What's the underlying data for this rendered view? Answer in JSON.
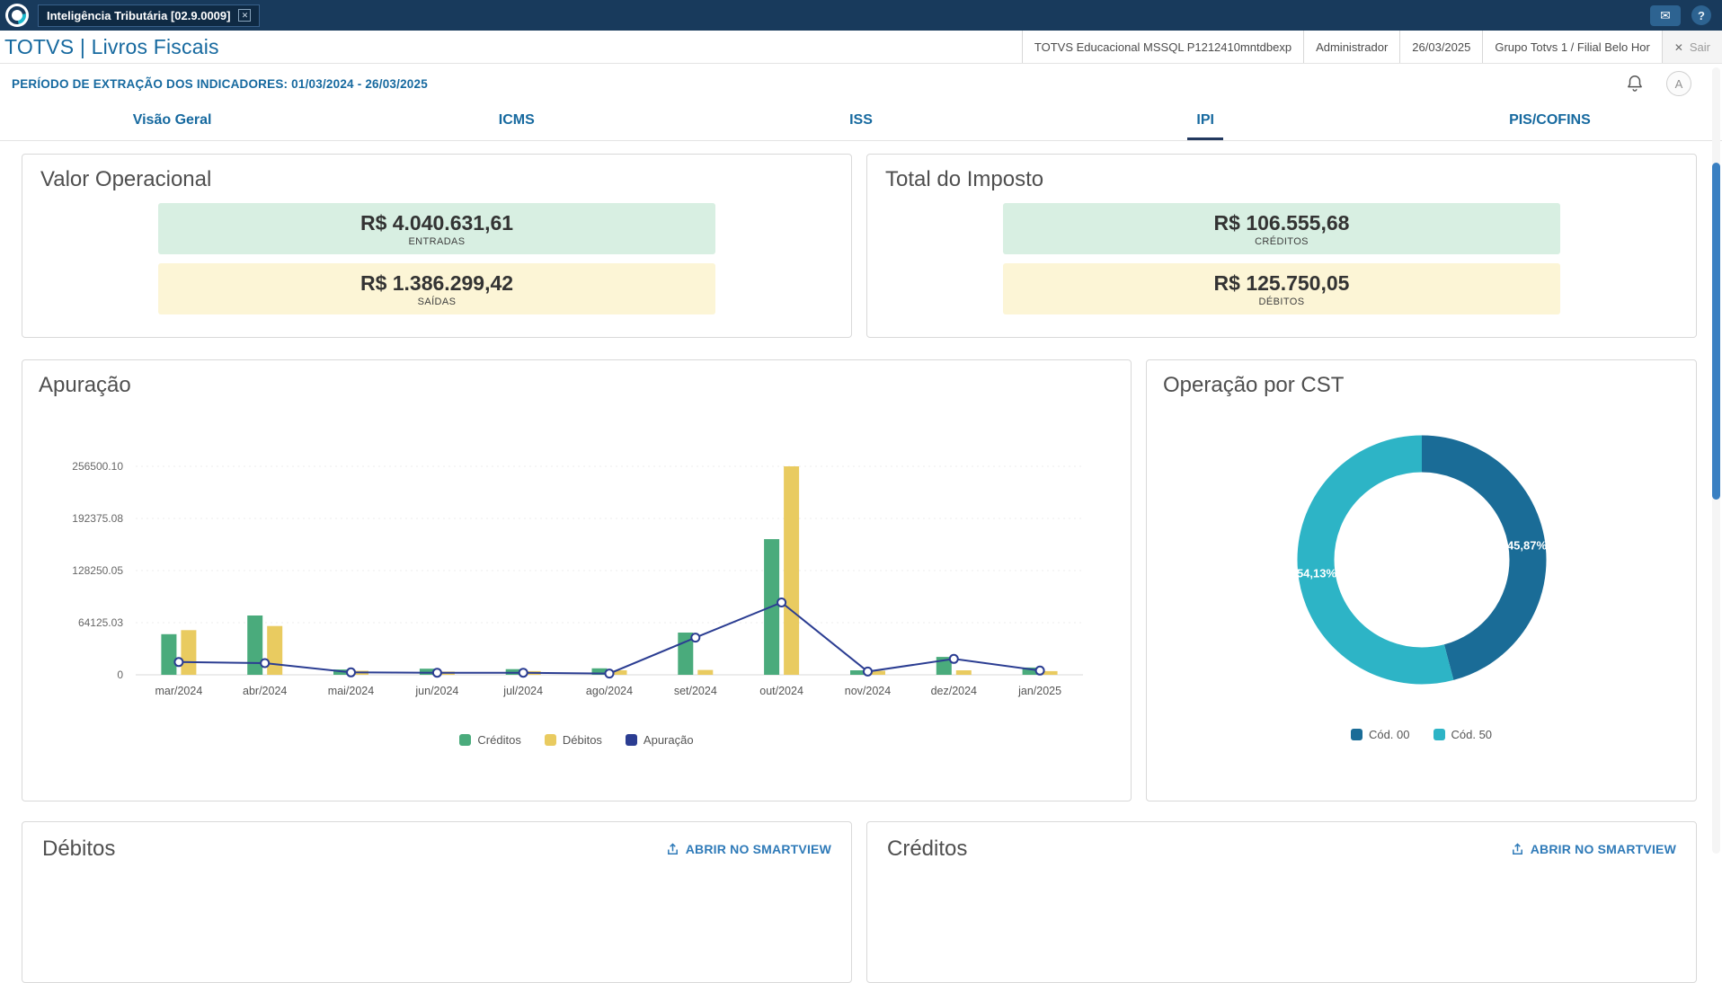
{
  "topbar": {
    "tab_title": "Inteligência Tributária [02.9.0009]"
  },
  "header": {
    "app_title": "TOTVS | Livros Fiscais",
    "environment": "TOTVS Educacional MSSQL P1212410mntdbexp",
    "user": "Administrador",
    "date": "26/03/2025",
    "branch": "Grupo Totvs 1 / Filial Belo Hor",
    "logout_label": "Sair"
  },
  "period_label": "PERÍODO DE EXTRAÇÃO DOS INDICADORES: 01/03/2024 - 26/03/2025",
  "avatar_letter": "A",
  "tabs": [
    {
      "label": "Visão Geral"
    },
    {
      "label": "ICMS"
    },
    {
      "label": "ISS"
    },
    {
      "label": "IPI"
    },
    {
      "label": "PIS/COFINS"
    }
  ],
  "active_tab": "IPI",
  "summary_cards": {
    "valor_operacional": {
      "title": "Valor Operacional",
      "entries": {
        "value": "R$ 4.040.631,61",
        "label": "ENTRADAS"
      },
      "exits": {
        "value": "R$ 1.386.299,42",
        "label": "SAÍDAS"
      }
    },
    "total_imposto": {
      "title": "Total do Imposto",
      "credits": {
        "value": "R$ 106.555,68",
        "label": "CRÉDITOS"
      },
      "debits": {
        "value": "R$ 125.750,05",
        "label": "DÉBITOS"
      }
    }
  },
  "bottom_cards": {
    "debitos": {
      "title": "Débitos",
      "link": "ABRIR NO SMARTVIEW"
    },
    "creditos": {
      "title": "Créditos",
      "link": "ABRIR NO SMARTVIEW"
    }
  },
  "colors": {
    "entry_bg": "#d8efe2",
    "exit_bg": "#fcf5d6",
    "credit_green": "#4aab7c",
    "debit_yellow": "#e9cb60",
    "line_navy": "#2b3d92",
    "cst00_blue": "#1a6c97",
    "cst50_teal": "#2db4c6",
    "accent_blue": "#16699f",
    "topbar_navy": "#183a5c"
  },
  "chart_data": [
    {
      "type": "bar",
      "title": "Apuração",
      "categories": [
        "mar/2024",
        "abr/2024",
        "mai/2024",
        "jun/2024",
        "jul/2024",
        "ago/2024",
        "set/2024",
        "out/2024",
        "nov/2024",
        "dez/2024",
        "jan/2025"
      ],
      "series": [
        {
          "name": "Créditos",
          "kind": "bar",
          "color": "#4aab7c",
          "values": [
            50000,
            73000,
            6500,
            7500,
            7000,
            8000,
            52000,
            167000,
            5500,
            22000,
            9000
          ]
        },
        {
          "name": "Débitos",
          "kind": "bar",
          "color": "#e9cb60",
          "values": [
            55000,
            60000,
            5000,
            4000,
            4500,
            5500,
            6000,
            256500,
            5000,
            5500,
            4500
          ]
        },
        {
          "name": "Apuração",
          "kind": "line",
          "color": "#2b3d92",
          "values": [
            15700,
            14400,
            3000,
            2500,
            2500,
            1500,
            45800,
            89000,
            4000,
            19600,
            5200
          ]
        }
      ],
      "yticks": [
        0,
        64125.03,
        128250.05,
        192375.08,
        256500.1
      ],
      "ytick_labels": [
        "0",
        "64125.03",
        "128250.05",
        "192375.08",
        "256500.10"
      ],
      "ylim": [
        0,
        256500.1
      ],
      "xlabel": "",
      "ylabel": "",
      "grid": "dotted-horizontal",
      "legend_position": "bottom"
    },
    {
      "type": "pie",
      "title": "Operação por CST",
      "donut": true,
      "slices": [
        {
          "name": "Cód. 00",
          "value": 45.87,
          "label": "45,87%",
          "color": "#1a6c97"
        },
        {
          "name": "Cód. 50",
          "value": 54.13,
          "label": "54,13%",
          "color": "#2db4c6"
        }
      ],
      "legend_position": "bottom"
    }
  ]
}
